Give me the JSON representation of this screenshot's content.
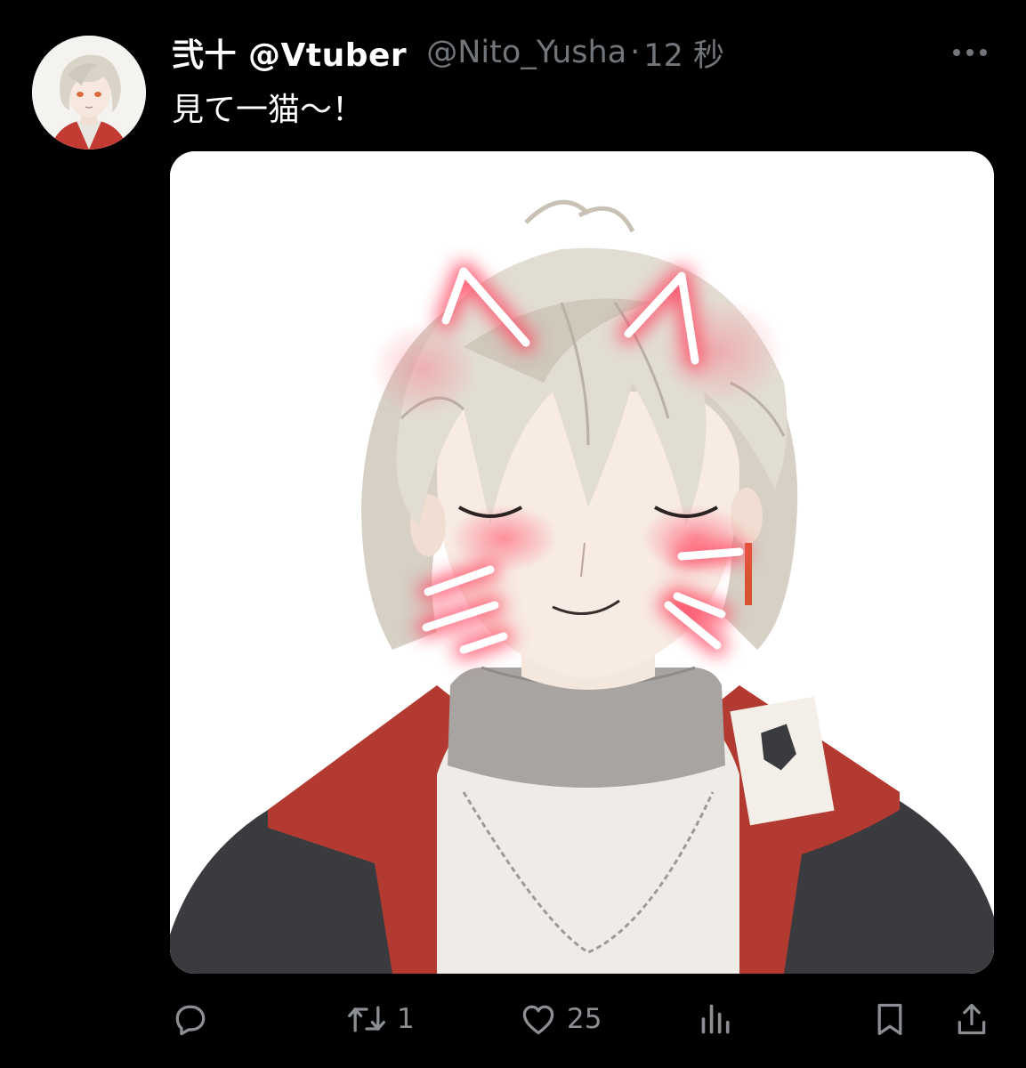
{
  "tweet": {
    "display_name": "弐十 @Vtuber",
    "handle": "@Nito_Yusha",
    "separator": "·",
    "time": "12 秒",
    "text": "見て一猫〜！",
    "more_icon": "ellipsis-icon",
    "media_alt_subject": "anime-character-illustration"
  },
  "actions": {
    "reply": {
      "icon": "reply-bubble-icon",
      "count": ""
    },
    "retweet": {
      "icon": "retweet-icon",
      "count": "1"
    },
    "like": {
      "icon": "heart-icon",
      "count": "25"
    },
    "views": {
      "icon": "bar-chart-icon",
      "count": ""
    },
    "bookmark": {
      "icon": "bookmark-icon",
      "count": ""
    },
    "share": {
      "icon": "share-upload-icon",
      "count": ""
    }
  },
  "colors": {
    "background": "#000000",
    "name": "#ffffff",
    "secondary": "#71767b",
    "action_icon": "#8b8f94",
    "neon_glow": "#ff5a6e"
  }
}
